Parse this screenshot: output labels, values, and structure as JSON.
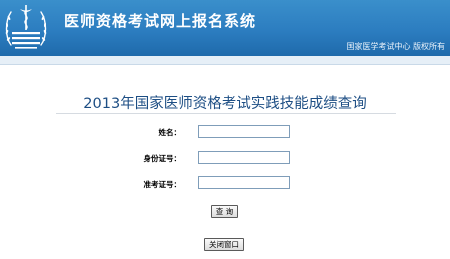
{
  "header": {
    "logo_text": "国家医学考试中心 NMEC",
    "title": "医师资格考试网上报名系统",
    "copyright": "国家医学考试中心  版权所有"
  },
  "main": {
    "title": "2013年国家医师资格考试实践技能成绩查询",
    "fields": [
      {
        "label": "姓名：",
        "value": "",
        "placeholder": ""
      },
      {
        "label": "身份证号：",
        "value": "",
        "placeholder": ""
      },
      {
        "label": "准考证号：",
        "value": "",
        "placeholder": ""
      }
    ],
    "query_button": "查 询",
    "close_button": "关闭窗口"
  },
  "colors": {
    "header_bg": "#2c7dc0",
    "title_color": "#1d4e84"
  }
}
